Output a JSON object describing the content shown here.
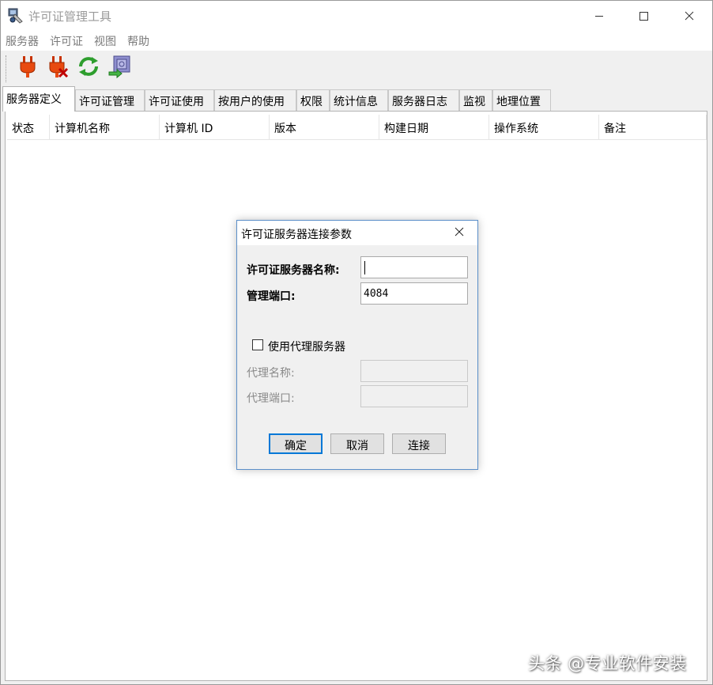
{
  "window": {
    "title": "许可证管理工具",
    "icons": {
      "app": "license-tool-app-icon",
      "minimize": "minimize-icon",
      "maximize": "maximize-icon",
      "close": "close-icon"
    }
  },
  "menu": {
    "items": [
      {
        "label": "服务器"
      },
      {
        "label": "许可证"
      },
      {
        "label": "视图"
      },
      {
        "label": "帮助"
      }
    ]
  },
  "toolbar": {
    "buttons": [
      {
        "icon": "plug-connect-icon"
      },
      {
        "icon": "plug-disconnect-icon"
      },
      {
        "icon": "refresh-icon"
      },
      {
        "icon": "export-icon"
      }
    ]
  },
  "tabs": {
    "items": [
      {
        "label": "服务器定义",
        "active": true
      },
      {
        "label": "许可证管理"
      },
      {
        "label": "许可证使用"
      },
      {
        "label": "按用户的使用"
      },
      {
        "label": "权限"
      },
      {
        "label": "统计信息"
      },
      {
        "label": "服务器日志"
      },
      {
        "label": "监视"
      },
      {
        "label": "地理位置"
      }
    ]
  },
  "table": {
    "columns": [
      "状态",
      "计算机名称",
      "计算机 ID",
      "版本",
      "构建日期",
      "操作系统",
      "备注"
    ]
  },
  "dialog": {
    "title": "许可证服务器连接参数",
    "server_name_label": "许可证服务器名称:",
    "server_name_value": "",
    "port_label": "管理端口:",
    "port_value": "4084",
    "use_proxy_label": "使用代理服务器",
    "use_proxy_checked": false,
    "proxy_name_label": "代理名称:",
    "proxy_port_label": "代理端口:",
    "ok_label": "确定",
    "cancel_label": "取消",
    "connect_label": "连接"
  },
  "watermark": "头条 @专业软件安装",
  "colors": {
    "accent": "#0078d7",
    "dialog_border": "#5b8fc9",
    "disabled_text": "#8a8a8a"
  }
}
